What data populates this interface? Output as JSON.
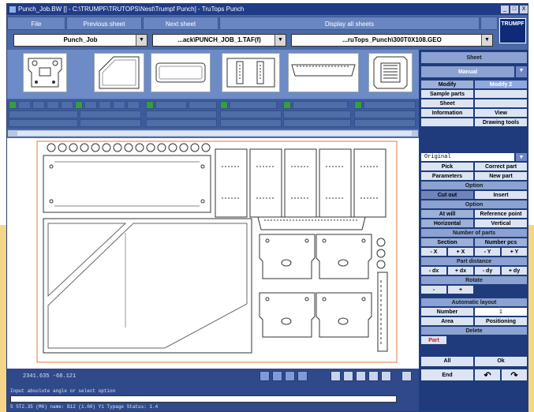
{
  "window": {
    "title": "Punch_Job.BW [] - C:\\TRUMPF\\TRUTOPS\\Nest\\Trumpf Punch] - TruTops Punch",
    "btn_min": "_",
    "btn_max": "□",
    "btn_close": "X"
  },
  "menu": {
    "file": "File",
    "prev": "Previous sheet",
    "next": "Next sheet",
    "display": "Display all sheets",
    "logo": "TRUMPF"
  },
  "combos": {
    "job": "Punch_Job",
    "file1": "...ack\\PUNCH_JOB_1.TAF(f)",
    "file2": "...ruTops_Punch\\300T0X108.GEO",
    "arrow": "▼"
  },
  "status": {
    "coords": "2341.635    -68.121",
    "prompt": "Input absolute angle or select option",
    "statline": "S  ST2.35 (M6)  name: B12  (1.00)  Y1  Typage    Status: 1.4"
  },
  "panel": {
    "sheet": "Sheet",
    "manual": "Manual",
    "modify": "Modify",
    "modify2": "Modify 2",
    "sample": "Sample parts",
    "sheet2": "Sheet",
    "information": "Information",
    "view": "View",
    "drawing_tools": "Drawing tools",
    "original": "Original",
    "pick": "Pick",
    "correct": "Correct part",
    "parameters": "Parameters",
    "new_part": "New part",
    "option1": "Option",
    "cut_out": "Cut out",
    "insert": "Insert",
    "option2": "Option",
    "at_will": "At will",
    "ref_point": "Reference point",
    "horizontal": "Horizontal",
    "vertical": "Vertical",
    "num_parts": "Number of parts",
    "section": "Section",
    "number_pcs": "Number pcs",
    "mx": "- X",
    "px": "+ X",
    "my": "- Y",
    "py": "+ Y",
    "part_distance": "Part distance",
    "mdx": "- dx",
    "pdx": "+ dx",
    "mdy": "- dy",
    "pdy": "+ dy",
    "rotate": "Rotate",
    "rot_minus": "-",
    "rot_plus": "+",
    "auto_layout": "Automatic layout",
    "number": "Number",
    "number_val": "1",
    "area": "Area",
    "positioning": "Positioning",
    "delete": "Delete",
    "part": "Part",
    "all": "All",
    "ok": "Ok",
    "end": "End"
  },
  "colors": {
    "accent": "#1f3b7c",
    "manual": "#a94444"
  }
}
